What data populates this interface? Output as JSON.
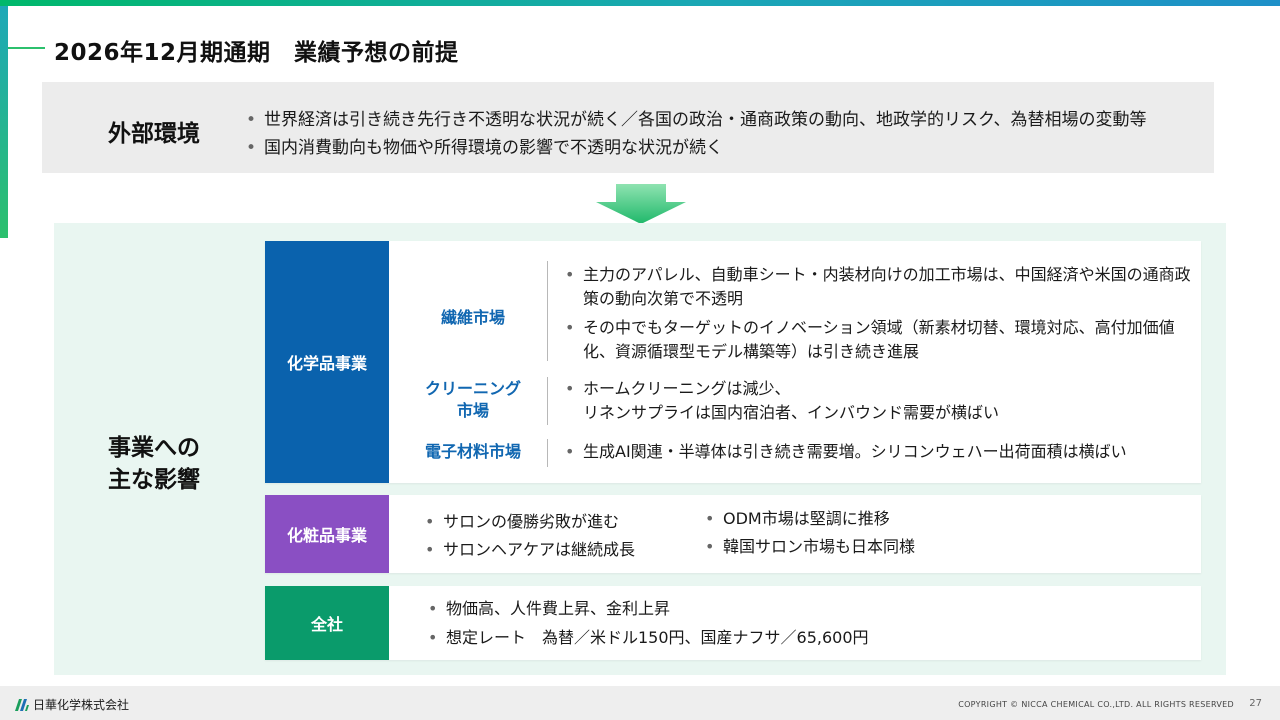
{
  "title": "2026年12月期通期　業績予想の前提",
  "external": {
    "label": "外部環境",
    "bullets": [
      "世界経済は引き続き先行き不透明な状況が続く／各国の政治・通商政策の動向、地政学的リスク、為替相場の変動等",
      "国内消費動向も物価や所得環境の影響で不透明な状況が続く"
    ]
  },
  "impact": {
    "label_line1": "事業への",
    "label_line2": "主な影響"
  },
  "chemical": {
    "header": "化学品事業",
    "fiber": {
      "name": "繊維市場",
      "bullets": [
        "主力のアパレル、自動車シート・内装材向けの加工市場は、中国経済や米国の通商政策の動向次第で不透明",
        "その中でもターゲットのイノベーション領域（新素材切替、環境対応、高付加価値化、資源循環型モデル構築等）は引き続き進展"
      ]
    },
    "cleaning": {
      "name_line1": "クリーニング",
      "name_line2": "市場",
      "line1": "ホームクリーニングは減少、",
      "line2": "リネンサプライは国内宿泊者、インバウンド需要が横ばい"
    },
    "electronic": {
      "name": "電子材料市場",
      "bullets": [
        "生成AI関連・半導体は引き続き需要増。シリコンウェハー出荷面積は横ばい"
      ]
    }
  },
  "cosmetics": {
    "header": "化粧品事業",
    "bullets_left": [
      "サロンの優勝劣敗が進む",
      "サロンヘアケアは継続成長"
    ],
    "bullets_right": [
      "ODM市場は堅調に推移",
      "韓国サロン市場も日本同様"
    ]
  },
  "company": {
    "header": "全社",
    "bullets": [
      "物価高、人件費上昇、金利上昇",
      "想定レート　為替／米ドル150円、国産ナフサ／65,600円"
    ]
  },
  "footer": {
    "logo_text": "日華化学株式会社",
    "copyright": "COPYRIGHT © NICCA CHEMICAL CO.,LTD. ALL RIGHTS RESERVED",
    "page": "27"
  },
  "colors": {
    "chemical": "#0a62ad",
    "cosmetics": "#8a4fc3",
    "company": "#0a9b6b",
    "market_text": "#1167b1",
    "accent_green": "#2cc06d",
    "panel_bg": "#e9f6f1"
  },
  "icons": [
    "down-arrow-icon",
    "nicca-logo-icon"
  ]
}
